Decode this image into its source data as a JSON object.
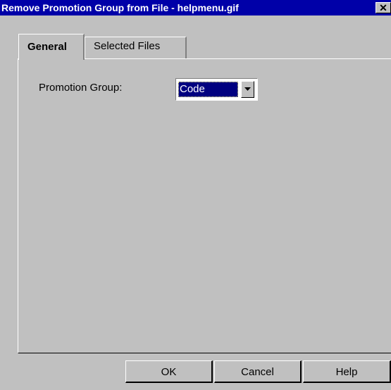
{
  "window": {
    "title": "Remove Promotion Group from File - helpmenu.gif",
    "close_glyph": "✕",
    "close_icon": "close-icon"
  },
  "tabs": [
    {
      "label": "General",
      "active": true
    },
    {
      "label": "Selected Files",
      "active": false
    }
  ],
  "form": {
    "promotion_group_label": "Promotion Group:",
    "promotion_group_value": "Code",
    "dropdown_icon": "chevron-down-icon"
  },
  "buttons": {
    "ok": "OK",
    "cancel": "Cancel",
    "help": "Help"
  },
  "colors": {
    "titlebar": "#0000a8",
    "face": "#c0c0c0",
    "selection": "#000080"
  }
}
